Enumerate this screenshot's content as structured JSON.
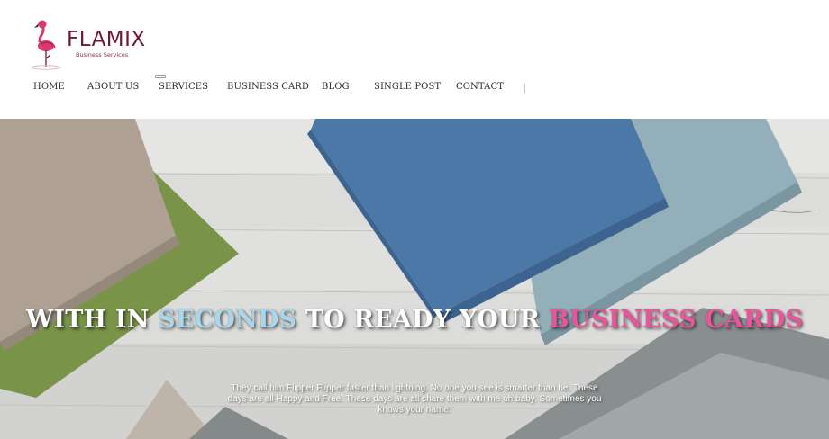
{
  "brand": {
    "name": "FLAMIX",
    "tagline": "Business Services",
    "colors": {
      "primary": "#6d1a38",
      "flamingo": "#d8386e"
    }
  },
  "nav": {
    "items": [
      {
        "label": "HOME"
      },
      {
        "label": "ABOUT US"
      },
      {
        "label": "SERVICES"
      },
      {
        "label": "BUSINESS CARD"
      },
      {
        "label": "BLOG"
      },
      {
        "label": "SINGLE POST"
      },
      {
        "label": "CONTACT"
      }
    ],
    "divider": "|"
  },
  "hero": {
    "title": {
      "part1": "WITH IN ",
      "highlight1": "SECONDS",
      "part2": " TO READY YOUR ",
      "highlight2": "BUSINESS CARDS"
    },
    "text": "They call him Flipper Flipper faster than lightning. No one you see is smarter than he. These days are all Happy and Free. These days are all share them with me oh baby. Sometimes you knows your name.",
    "colors": {
      "highlight_blue": "#a9d6ec",
      "highlight_pink": "#e8559b"
    }
  }
}
